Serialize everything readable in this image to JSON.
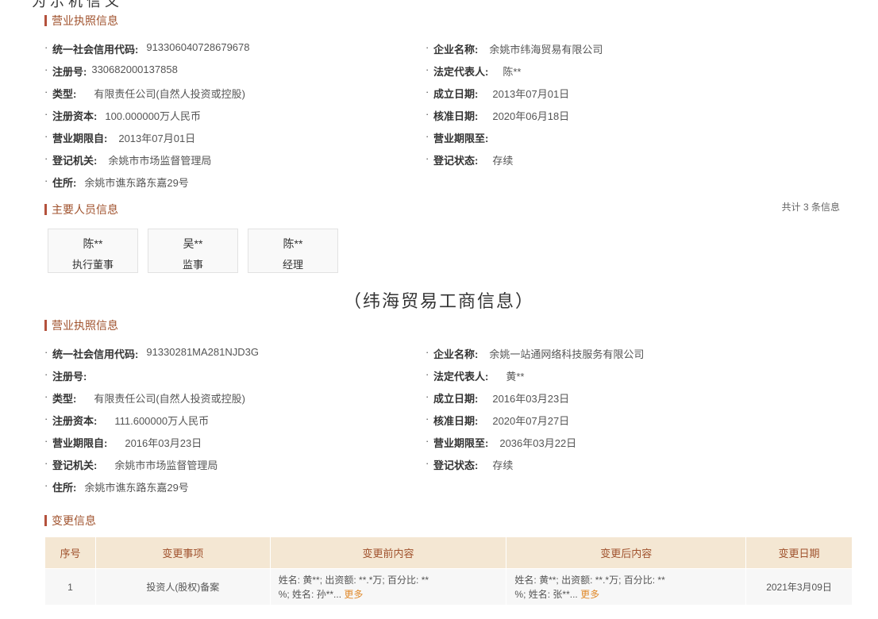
{
  "top_fragment": "为    示 机 信 义",
  "sections": {
    "license1_title": "营业执照信息",
    "persons_title": "主要人员信息",
    "license2_title": "营业执照信息",
    "changes_title": "变更信息"
  },
  "license1": {
    "credit_code_label": "统一社会信用代码:",
    "credit_code": "913306040728679678",
    "company_name_label": "企业名称:",
    "company_name": "余姚市纬海贸易有限公司",
    "reg_no_label": "注册号:",
    "reg_no": "330682000137858",
    "legal_rep_label": "法定代表人:",
    "legal_rep": "陈**",
    "type_label": "类型:",
    "type": "有限责任公司(自然人投资或控股)",
    "founded_label": "成立日期:",
    "founded": "2013年07月01日",
    "capital_label": "注册资本:",
    "capital": "100.000000万人民币",
    "approved_label": "核准日期:",
    "approved": "2020年06月18日",
    "term_from_label": "营业期限自:",
    "term_from": "2013年07月01日",
    "term_to_label": "营业期限至:",
    "term_to": "",
    "authority_label": "登记机关:",
    "authority": "余姚市市场监督管理局",
    "status_label": "登记状态:",
    "status": "存续",
    "address_label": "住所:",
    "address": "余姚市谯东路东嘉29号"
  },
  "persons": {
    "total": "共计 3 条信息",
    "items": [
      {
        "name": "陈**",
        "role": "执行董事"
      },
      {
        "name": "吴**",
        "role": "监事"
      },
      {
        "name": "陈**",
        "role": "经理"
      }
    ]
  },
  "caption": "（纬海贸易工商信息）",
  "license2": {
    "credit_code_label": "统一社会信用代码:",
    "credit_code": "91330281MA281NJD3G",
    "company_name_label": "企业名称:",
    "company_name": "余姚一站通网络科技服务有限公司",
    "reg_no_label": "注册号:",
    "reg_no": "",
    "legal_rep_label": "法定代表人:",
    "legal_rep": "黄**",
    "type_label": "类型:",
    "type": "有限责任公司(自然人投资或控股)",
    "founded_label": "成立日期:",
    "founded": "2016年03月23日",
    "capital_label": "注册资本:",
    "capital": "111.600000万人民币",
    "approved_label": "核准日期:",
    "approved": "2020年07月27日",
    "term_from_label": "营业期限自:",
    "term_from": "2016年03月23日",
    "term_to_label": "营业期限至:",
    "term_to": "2036年03月22日",
    "authority_label": "登记机关:",
    "authority": "余姚市市场监督管理局",
    "status_label": "登记状态:",
    "status": "存续",
    "address_label": "住所:",
    "address": "余姚市谯东路东嘉29号"
  },
  "changes": {
    "headers": [
      "序号",
      "变更事项",
      "变更前内容",
      "变更后内容",
      "变更日期"
    ],
    "rows": [
      {
        "no": "1",
        "item": "投资人(股权)备案",
        "before_l1": "姓名: 黄**; 出资额: **.*万; 百分比: **",
        "before_l2": "%; 姓名: 孙**...",
        "after_l1": "姓名: 黄**; 出资额: **.*万; 百分比: **",
        "after_l2": "%; 姓名: 张**...",
        "more": "更多",
        "date": "2021年3月09日"
      }
    ]
  },
  "colors": {
    "accent": "#a0522d",
    "bar": "#b4513c",
    "table_header_bg": "#f4e7d3",
    "link": "#e08a2c"
  }
}
